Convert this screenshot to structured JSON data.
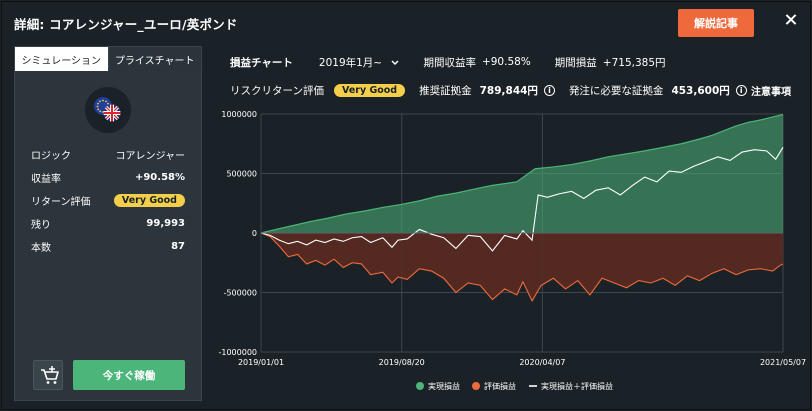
{
  "header": {
    "title": "詳細: コアレンジャー_ユーロ/英ポンド",
    "commentary_button": "解説記事"
  },
  "left_panel": {
    "tabs": [
      "シミュレーション",
      "プライスチャート"
    ],
    "stats": [
      {
        "label": "ロジック",
        "value": "コアレンジャー"
      },
      {
        "label": "収益率",
        "value": "+90.58%"
      },
      {
        "label": "リターン評価",
        "value": "Very Good"
      },
      {
        "label": "残り",
        "value": "99,993"
      },
      {
        "label": "本数",
        "value": "87"
      }
    ],
    "start_button": "今すぐ稼働"
  },
  "toolbar": {
    "chart_label": "損益チャート",
    "period_select": "2019年1月~",
    "period_return_label": "期間収益率",
    "period_return_value": "+90.58%",
    "period_pnl_label": "期間損益",
    "period_pnl_value": "+715,385円"
  },
  "risk_row": {
    "risk_label": "リスクリターン評価",
    "risk_badge": "Very Good",
    "recommended_label": "推奨証拠金",
    "recommended_value": "789,844円",
    "required_label": "発注に必要な証拠金",
    "required_value": "453,600円",
    "caution_link": "注意事項"
  },
  "colors": {
    "realized": "#4cb57a",
    "unrealized": "#ee6a3c",
    "combined": "#ffffff",
    "accent_orange": "#ee6a3c",
    "badge_yellow": "#f4cf4b",
    "go_green": "#4cb57a"
  },
  "chart_data": {
    "type": "area",
    "x_ticks": [
      "2019/01/01",
      "2019/08/20",
      "2020/04/07",
      "2021/05/07"
    ],
    "y_ticks": [
      "1000000",
      "500000",
      "0",
      "-500000",
      "-1000000"
    ],
    "ylim": [
      -1000000,
      1000000
    ],
    "x_domain_days": [
      0,
      857
    ],
    "legend_position": "bottom",
    "grid": true,
    "series": [
      {
        "name": "実現損益",
        "style": "area",
        "color": "#4cb57a",
        "points": [
          [
            0,
            0
          ],
          [
            20,
            25000
          ],
          [
            50,
            60000
          ],
          [
            80,
            95000
          ],
          [
            110,
            125000
          ],
          [
            140,
            160000
          ],
          [
            170,
            185000
          ],
          [
            200,
            215000
          ],
          [
            230,
            240000
          ],
          [
            260,
            270000
          ],
          [
            290,
            310000
          ],
          [
            320,
            335000
          ],
          [
            360,
            380000
          ],
          [
            380,
            400000
          ],
          [
            420,
            430000
          ],
          [
            450,
            540000
          ],
          [
            480,
            555000
          ],
          [
            510,
            575000
          ],
          [
            540,
            605000
          ],
          [
            570,
            640000
          ],
          [
            600,
            665000
          ],
          [
            630,
            690000
          ],
          [
            660,
            720000
          ],
          [
            690,
            750000
          ],
          [
            720,
            790000
          ],
          [
            740,
            820000
          ],
          [
            760,
            860000
          ],
          [
            780,
            900000
          ],
          [
            800,
            930000
          ],
          [
            820,
            950000
          ],
          [
            840,
            975000
          ],
          [
            857,
            995000
          ]
        ]
      },
      {
        "name": "評価損益",
        "style": "line",
        "color": "#ee6a3c",
        "points": [
          [
            0,
            0
          ],
          [
            15,
            -30000
          ],
          [
            30,
            -110000
          ],
          [
            45,
            -200000
          ],
          [
            60,
            -180000
          ],
          [
            75,
            -260000
          ],
          [
            90,
            -230000
          ],
          [
            105,
            -270000
          ],
          [
            120,
            -220000
          ],
          [
            135,
            -290000
          ],
          [
            150,
            -250000
          ],
          [
            165,
            -260000
          ],
          [
            180,
            -350000
          ],
          [
            200,
            -330000
          ],
          [
            215,
            -420000
          ],
          [
            225,
            -370000
          ],
          [
            240,
            -390000
          ],
          [
            260,
            -300000
          ],
          [
            280,
            -320000
          ],
          [
            300,
            -380000
          ],
          [
            320,
            -500000
          ],
          [
            340,
            -420000
          ],
          [
            360,
            -440000
          ],
          [
            380,
            -560000
          ],
          [
            400,
            -470000
          ],
          [
            420,
            -520000
          ],
          [
            430,
            -410000
          ],
          [
            445,
            -570000
          ],
          [
            460,
            -440000
          ],
          [
            480,
            -380000
          ],
          [
            500,
            -470000
          ],
          [
            520,
            -400000
          ],
          [
            540,
            -520000
          ],
          [
            560,
            -380000
          ],
          [
            580,
            -420000
          ],
          [
            600,
            -460000
          ],
          [
            620,
            -400000
          ],
          [
            640,
            -420000
          ],
          [
            660,
            -380000
          ],
          [
            680,
            -440000
          ],
          [
            700,
            -360000
          ],
          [
            720,
            -400000
          ],
          [
            740,
            -340000
          ],
          [
            760,
            -300000
          ],
          [
            780,
            -350000
          ],
          [
            800,
            -310000
          ],
          [
            820,
            -300000
          ],
          [
            840,
            -320000
          ],
          [
            850,
            -280000
          ],
          [
            857,
            -260000
          ]
        ]
      },
      {
        "name": "実現損益＋評価損益",
        "style": "line",
        "color": "#ffffff",
        "points": [
          [
            0,
            0
          ],
          [
            15,
            -20000
          ],
          [
            30,
            -60000
          ],
          [
            45,
            -90000
          ],
          [
            60,
            -70000
          ],
          [
            75,
            -100000
          ],
          [
            90,
            -60000
          ],
          [
            105,
            -80000
          ],
          [
            120,
            -50000
          ],
          [
            135,
            -70000
          ],
          [
            150,
            -40000
          ],
          [
            165,
            -30000
          ],
          [
            180,
            -80000
          ],
          [
            200,
            -40000
          ],
          [
            215,
            -120000
          ],
          [
            225,
            -60000
          ],
          [
            240,
            -50000
          ],
          [
            260,
            30000
          ],
          [
            280,
            -10000
          ],
          [
            300,
            -40000
          ],
          [
            320,
            -130000
          ],
          [
            340,
            -20000
          ],
          [
            360,
            -30000
          ],
          [
            380,
            -150000
          ],
          [
            400,
            -20000
          ],
          [
            420,
            -50000
          ],
          [
            430,
            20000
          ],
          [
            445,
            -60000
          ],
          [
            455,
            320000
          ],
          [
            470,
            300000
          ],
          [
            490,
            330000
          ],
          [
            510,
            350000
          ],
          [
            530,
            290000
          ],
          [
            550,
            360000
          ],
          [
            570,
            380000
          ],
          [
            590,
            320000
          ],
          [
            610,
            400000
          ],
          [
            630,
            470000
          ],
          [
            650,
            430000
          ],
          [
            670,
            520000
          ],
          [
            690,
            510000
          ],
          [
            710,
            560000
          ],
          [
            730,
            600000
          ],
          [
            750,
            640000
          ],
          [
            770,
            610000
          ],
          [
            790,
            680000
          ],
          [
            810,
            700000
          ],
          [
            830,
            690000
          ],
          [
            845,
            620000
          ],
          [
            857,
            720000
          ]
        ]
      }
    ]
  }
}
